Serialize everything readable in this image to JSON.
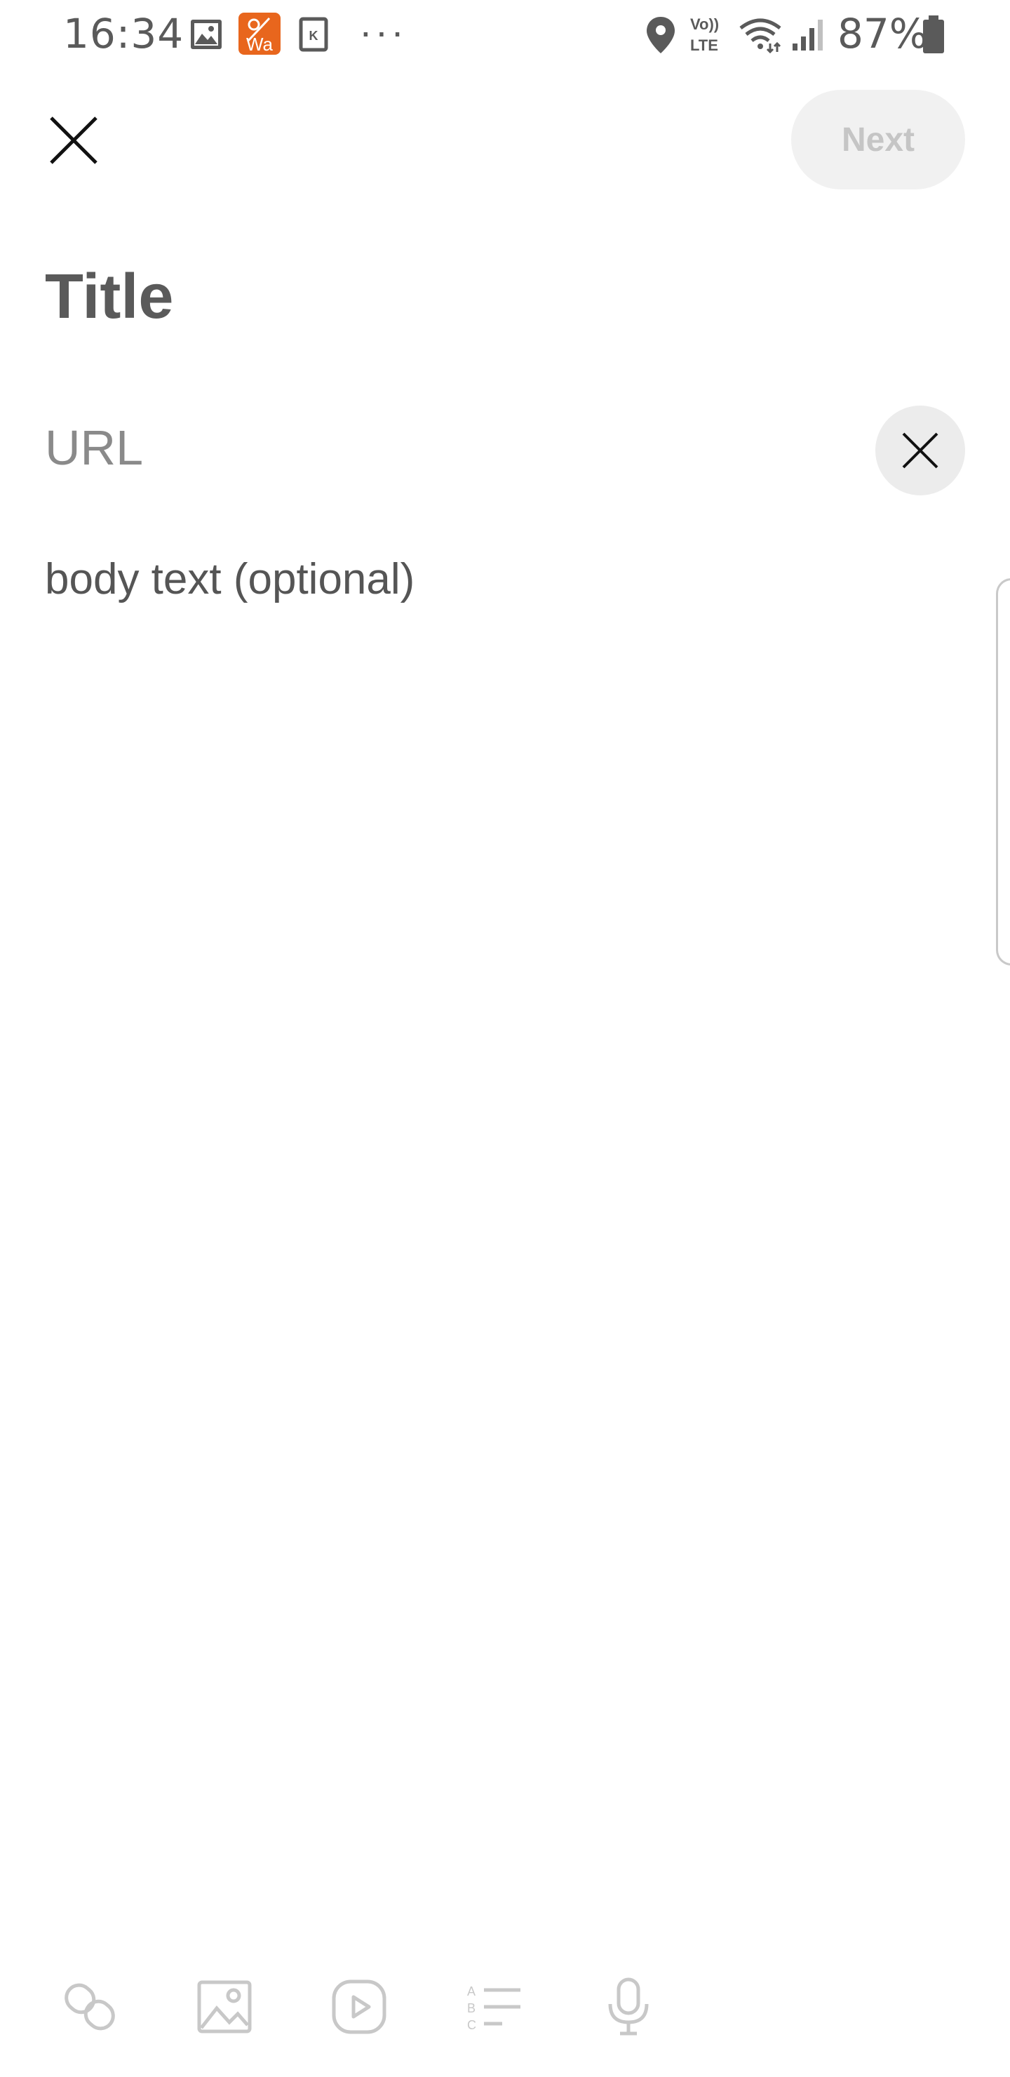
{
  "status_bar": {
    "time": "16:34",
    "battery": "87%",
    "overflow": "···",
    "icons": [
      "gallery-icon",
      "wa-app-icon",
      "k-app-icon",
      "location-icon",
      "volte-icon",
      "wifi-icon",
      "signal-icon",
      "battery-icon"
    ],
    "volte_top": "Vo))",
    "volte_bottom": "LTE",
    "wa_label": "Wa",
    "k_label": "K"
  },
  "header": {
    "next_label": "Next"
  },
  "form": {
    "title_placeholder": "Title",
    "url_placeholder": "URL",
    "body_placeholder": "body text (optional)"
  },
  "toolbar": {
    "items": [
      "link-icon",
      "image-icon",
      "video-icon",
      "list-icon",
      "microphone-icon"
    ]
  },
  "colors": {
    "wa_accent": "#e8661d",
    "next_bg": "#f1f1f1",
    "next_text": "#c5c5c5",
    "icon_gray": "#c8c8c8"
  }
}
